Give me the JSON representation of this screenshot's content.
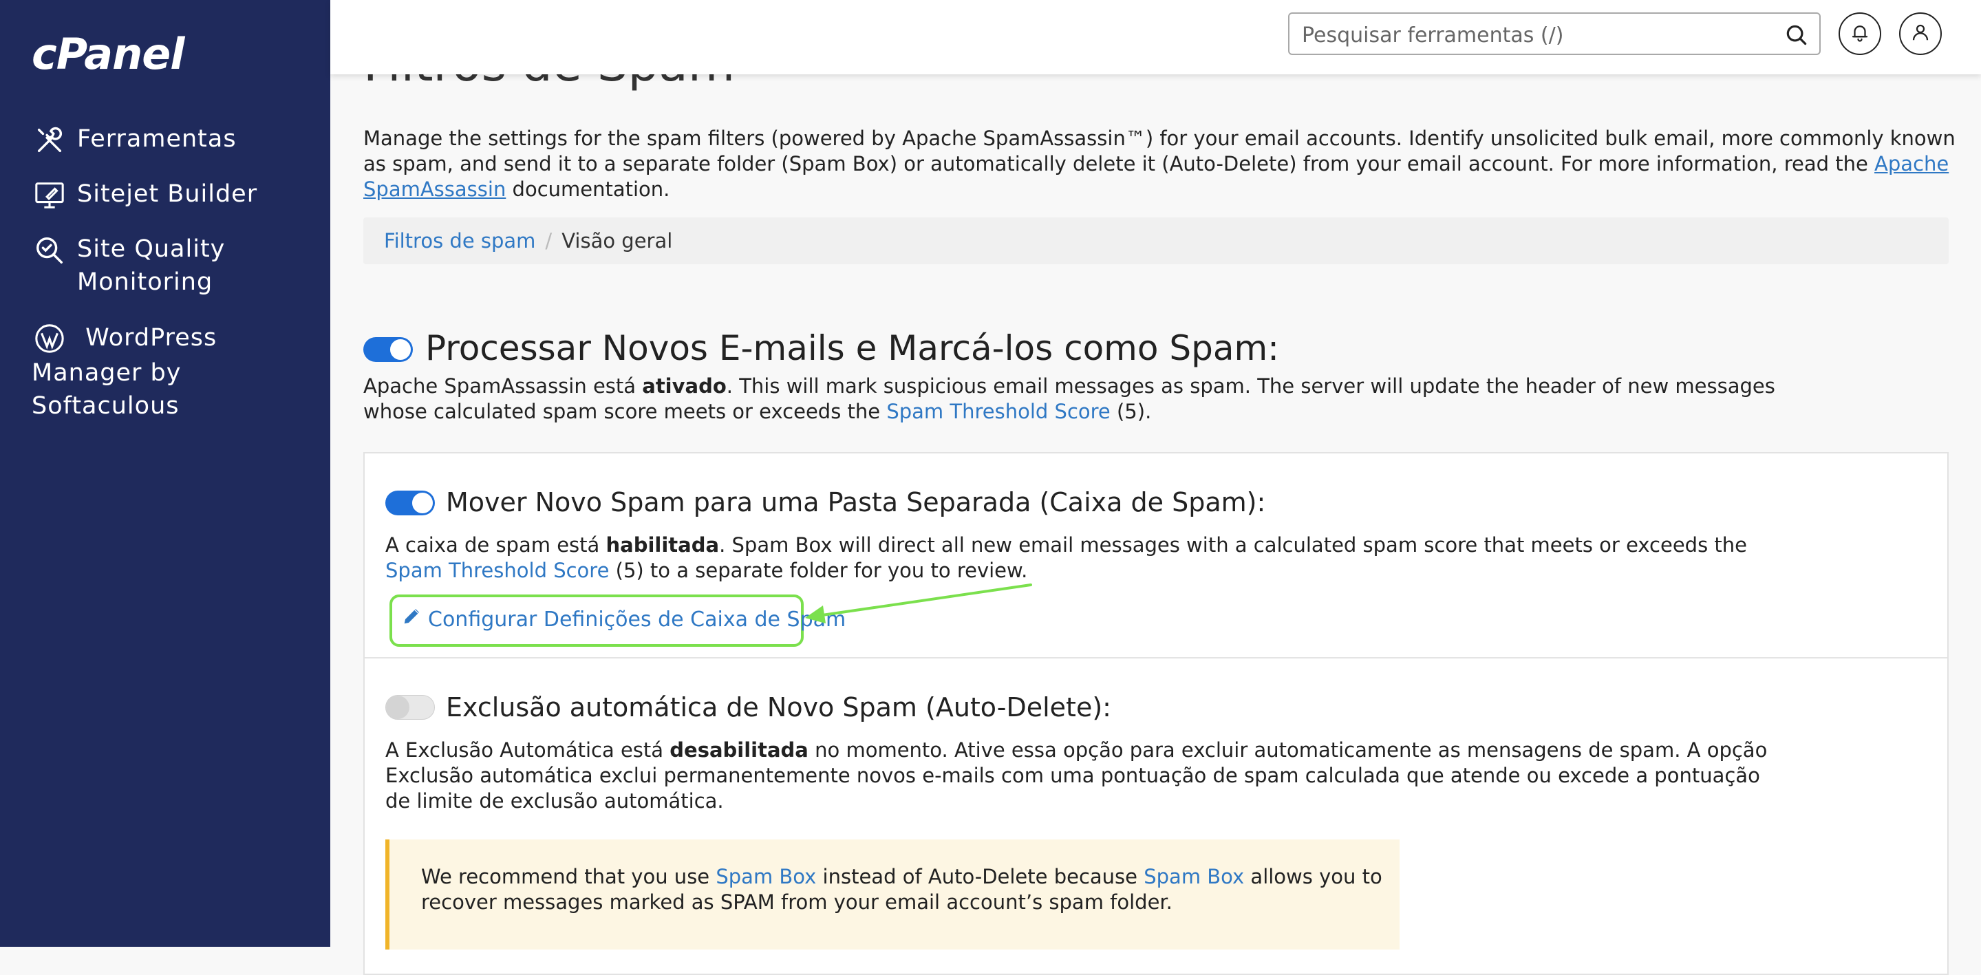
{
  "brand": {
    "logo_text": "cPanel"
  },
  "sidebar": {
    "items": [
      {
        "label": "Ferramentas",
        "icon": "tools-icon"
      },
      {
        "label": "Sitejet Builder",
        "icon": "monitor-edit-icon"
      },
      {
        "label": "Site Quality Monitoring",
        "icon": "magnifier-check-icon"
      },
      {
        "label": "WordPress Manager by Softaculous",
        "icon": "wordpress-icon"
      }
    ]
  },
  "header": {
    "search_placeholder": "Pesquisar ferramentas (/)",
    "icons": [
      "search-icon",
      "bell-icon",
      "user-icon"
    ]
  },
  "page": {
    "title": "Filtros de Spam",
    "description_part1": "Manage the settings for the spam filters (powered by Apache SpamAssassin™) for your email accounts. Identify unsolicited bulk email, more commonly known as spam, and send it to a separate folder (Spam Box) or automatically delete it (Auto-Delete) from your email account. For more information, read the ",
    "description_link": "Apache SpamAssassin",
    "description_part2": " documentation."
  },
  "breadcrumb": {
    "link": "Filtros de spam",
    "separator": "/",
    "current": "Visão geral"
  },
  "process_section": {
    "toggle_on": true,
    "title": "Processar Novos E-mails e Marcá-los como Spam:",
    "text_part1": "Apache SpamAssassin está ",
    "text_bold": "ativado",
    "text_part2": ". This will mark suspicious email messages as spam. The server will update the header of new messages whose calculated spam score meets or exceeds the ",
    "text_link": "Spam Threshold Score",
    "text_part3": " (5)."
  },
  "spam_box_section": {
    "toggle_on": true,
    "title": "Mover Novo Spam para uma Pasta Separada (Caixa de Spam):",
    "text_part1": "A caixa de spam está ",
    "text_bold": "habilitada",
    "text_part2": ". Spam Box will direct all new email messages with a calculated spam score that meets or exceeds the ",
    "text_link": "Spam Threshold Score",
    "text_part3": " (5) to a separate folder for you to review.",
    "config_link": "Configurar Definições de Caixa de Spam",
    "highlight_color": "#7be04d"
  },
  "auto_delete_section": {
    "toggle_on": false,
    "title": "Exclusão automática de Novo Spam (Auto-Delete):",
    "text_part1": "A Exclusão Automática está ",
    "text_bold": "desabilitada",
    "text_part2": " no momento. Ative essa opção para excluir automaticamente as mensagens de spam. A opção Exclusão automática exclui permanentemente novos e-mails com uma pontuação de spam calculada que atende ou excede a pontuação de limite de exclusão automática."
  },
  "notice": {
    "part1": "We recommend that you use ",
    "link1": "Spam Box",
    "part2": " instead of Auto-Delete because ",
    "link2": "Spam Box",
    "part3": " allows you to recover messages marked as SPAM from your email account’s spam folder."
  },
  "colors": {
    "sidebar_bg": "#1f2a5c",
    "accent": "#1e6fd9",
    "link": "#2f78c4",
    "notice_bg": "#fdf6e3",
    "notice_border": "#f0b429"
  }
}
